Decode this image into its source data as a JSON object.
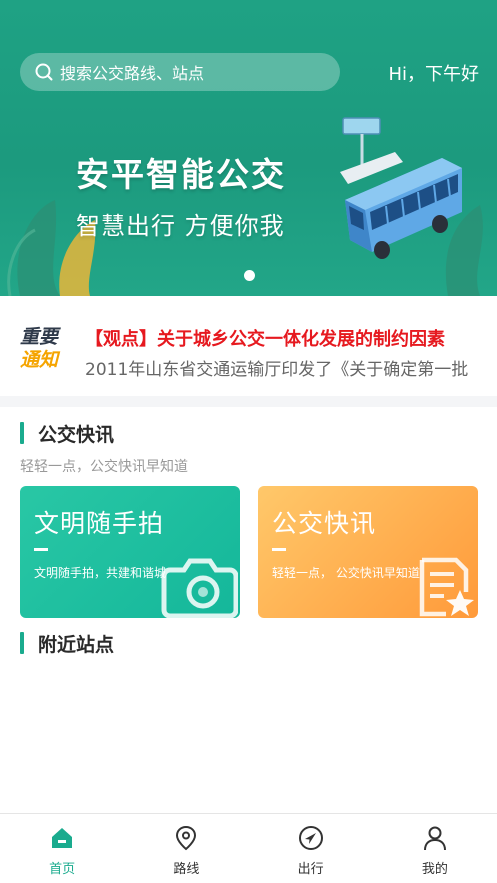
{
  "header": {
    "search_placeholder": "搜索公交路线、站点",
    "greeting": "Hi，下午好"
  },
  "banner": {
    "title": "安平智能公交",
    "slogan": "智慧出行 方便你我",
    "active_slide": 1,
    "slide_count": 1
  },
  "notice": {
    "badge_line1": "重要",
    "badge_line2": "通知",
    "headline": "【观点】关于城乡公交一体化发展的制约因素",
    "body": "2011年山东省交通运输厅印发了《关于确定第一批"
  },
  "news_section": {
    "title": "公交快讯",
    "subtitle": "轻轻一点，公交快讯早知道",
    "cards": [
      {
        "title": "文明随手拍",
        "desc": "文明随手拍，共建和谐城",
        "icon": "camera-icon",
        "color": "#1abc9c"
      },
      {
        "title": "公交快讯",
        "desc": "轻轻一点，  公交快讯早知道",
        "icon": "news-star-icon",
        "color": "#ffa94d"
      }
    ]
  },
  "nearby_section": {
    "title": "附近站点"
  },
  "tabbar": {
    "items": [
      {
        "label": "首页",
        "icon": "home-icon",
        "active": true
      },
      {
        "label": "路线",
        "icon": "location-pin-icon",
        "active": false
      },
      {
        "label": "出行",
        "icon": "navigation-arrow-icon",
        "active": false
      },
      {
        "label": "我的",
        "icon": "user-icon",
        "active": false
      }
    ]
  },
  "colors": {
    "brand": "#1aab8e",
    "notice_red": "#e6191f",
    "notice_gold": "#f5a400"
  }
}
